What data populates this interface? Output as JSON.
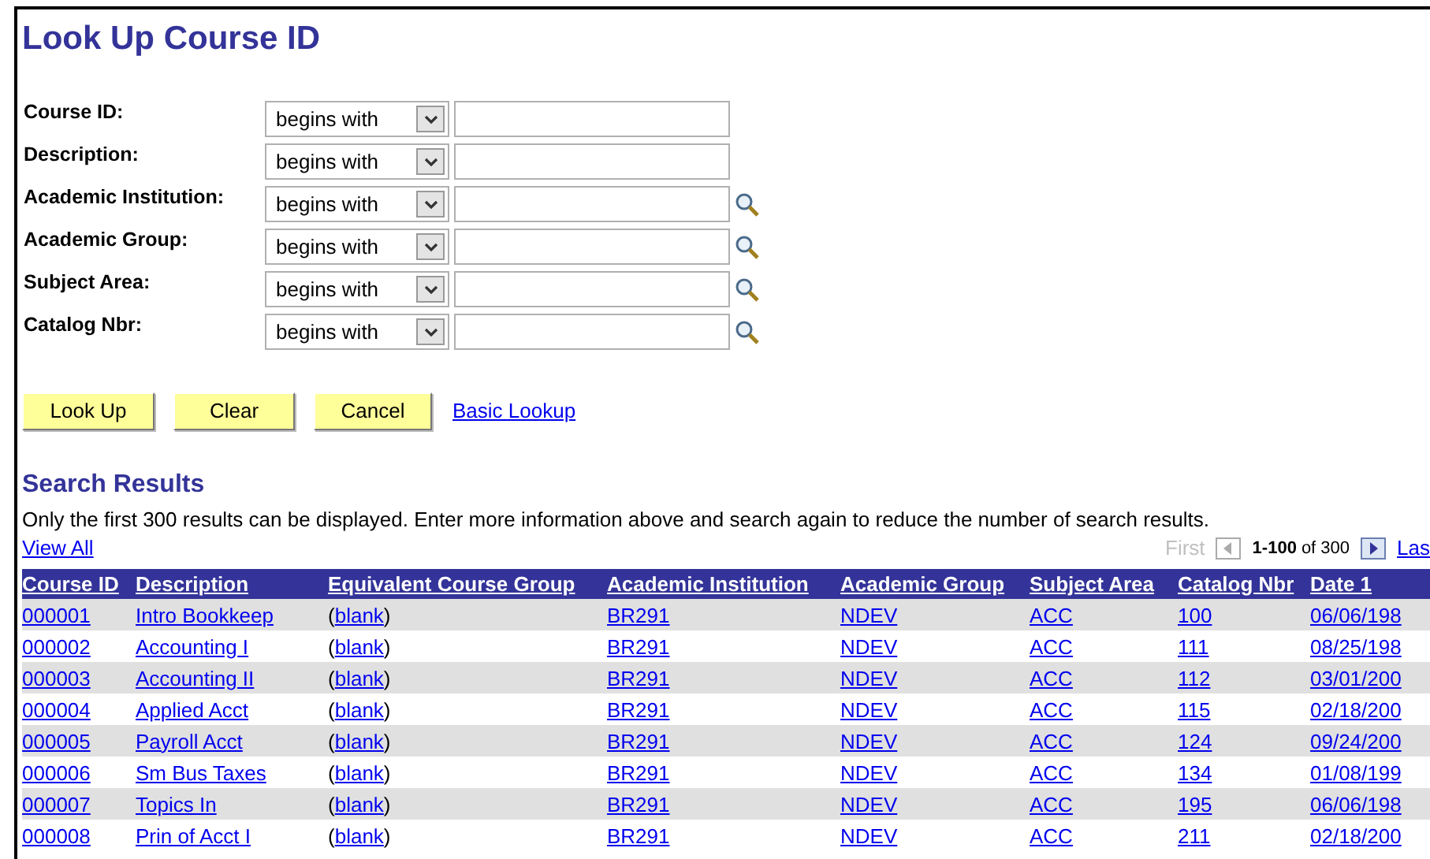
{
  "title": "Look Up Course ID",
  "criteria": [
    {
      "label": "Course ID:",
      "operator": "begins with",
      "lookup": false
    },
    {
      "label": "Description:",
      "operator": "begins with",
      "lookup": false
    },
    {
      "label": "Academic Institution:",
      "operator": "begins with",
      "lookup": true
    },
    {
      "label": "Academic Group:",
      "operator": "begins with",
      "lookup": true
    },
    {
      "label": "Subject Area:",
      "operator": "begins with",
      "lookup": true
    },
    {
      "label": "Catalog Nbr:",
      "operator": "begins with",
      "lookup": true
    }
  ],
  "buttons": [
    "Look Up",
    "Clear",
    "Cancel"
  ],
  "basic_lookup_link": "Basic Lookup",
  "results": {
    "heading": "Search Results",
    "notice": "Only the first 300 results can be displayed. Enter more information above and search again to reduce the number of search results.",
    "view_all": "View All",
    "pager": {
      "first": "First",
      "range": "1-100",
      "of": "of 300",
      "last": "Las"
    },
    "columns": [
      "Course ID",
      "Description",
      "Equivalent Course Group",
      "Academic Institution",
      "Academic Group",
      "Subject Area",
      "Catalog Nbr",
      "Date 1"
    ],
    "rows": [
      [
        "000001",
        "Intro Bookkeep",
        "(blank)",
        "BR291",
        "NDEV",
        "ACC",
        "100",
        "06/06/198"
      ],
      [
        "000002",
        "Accounting I",
        "(blank)",
        "BR291",
        "NDEV",
        "ACC",
        "111",
        "08/25/198"
      ],
      [
        "000003",
        "Accounting II",
        "(blank)",
        "BR291",
        "NDEV",
        "ACC",
        "112",
        "03/01/200"
      ],
      [
        "000004",
        "Applied Acct",
        "(blank)",
        "BR291",
        "NDEV",
        "ACC",
        "115",
        "02/18/200"
      ],
      [
        "000005",
        "Payroll Acct",
        "(blank)",
        "BR291",
        "NDEV",
        "ACC",
        "124",
        "09/24/200"
      ],
      [
        "000006",
        "Sm Bus Taxes",
        "(blank)",
        "BR291",
        "NDEV",
        "ACC",
        "134",
        "01/08/199"
      ],
      [
        "000007",
        "Topics In",
        "(blank)",
        "BR291",
        "NDEV",
        "ACC",
        "195",
        "06/06/198"
      ],
      [
        "000008",
        "Prin of Acct I",
        "(blank)",
        "BR291",
        "NDEV",
        "ACC",
        "211",
        "02/18/200"
      ]
    ]
  }
}
